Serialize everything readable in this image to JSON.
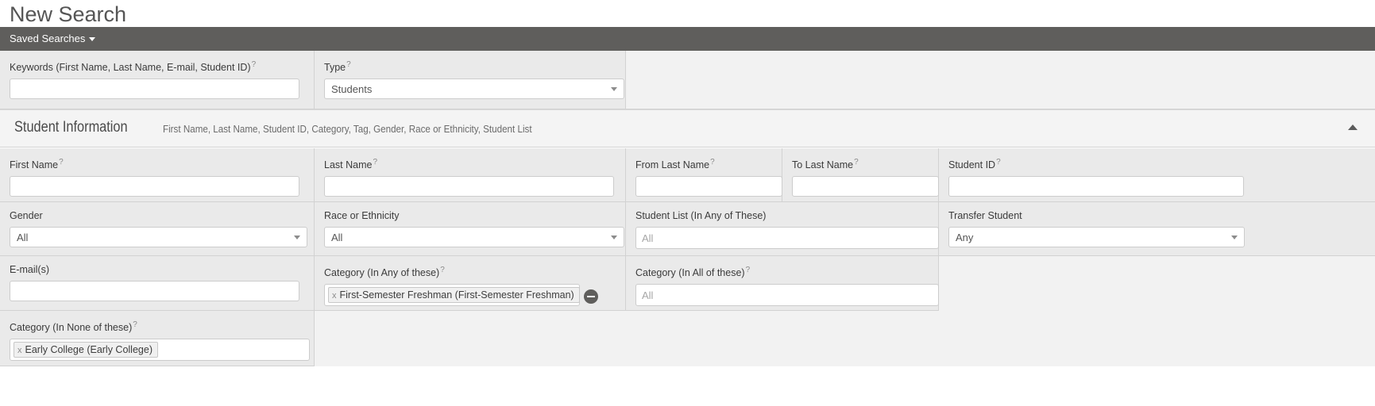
{
  "page": {
    "title": "New Search"
  },
  "toolbar": {
    "saved_searches_label": "Saved Searches"
  },
  "quick": {
    "keywords": {
      "label": "Keywords (First Name, Last Name, E-mail, Student ID)",
      "help": "?",
      "value": "",
      "placeholder": ""
    },
    "type": {
      "label": "Type",
      "help": "?",
      "value": "Students"
    }
  },
  "section": {
    "title": "Student Information",
    "subtitle": "First Name, Last Name, Student ID, Category, Tag, Gender, Race or Ethnicity, Student List",
    "collapse_icon": "caret-up-icon"
  },
  "fields": {
    "first_name": {
      "label": "First Name",
      "help": "?",
      "value": "",
      "placeholder": ""
    },
    "last_name": {
      "label": "Last Name",
      "help": "?",
      "value": "",
      "placeholder": ""
    },
    "from_last_name": {
      "label": "From Last Name",
      "help": "?",
      "value": "",
      "placeholder": ""
    },
    "to_last_name": {
      "label": "To Last Name",
      "help": "?",
      "value": "",
      "placeholder": ""
    },
    "student_id": {
      "label": "Student ID",
      "help": "?",
      "value": "",
      "placeholder": ""
    },
    "gender": {
      "label": "Gender",
      "value": "All"
    },
    "race": {
      "label": "Race or Ethnicity",
      "value": "All"
    },
    "student_list": {
      "label": "Student List (In Any of These)",
      "value": "",
      "placeholder": "All"
    },
    "transfer": {
      "label": "Transfer Student",
      "value": "Any"
    },
    "emails": {
      "label": "E-mail(s)",
      "value": "",
      "placeholder": ""
    },
    "category_any": {
      "label": "Category (In Any of these)",
      "help": "?",
      "chips": [
        {
          "remove": "x",
          "text": "First-Semester Freshman (First-Semester Freshman)"
        }
      ],
      "remove_button": "minus-icon"
    },
    "category_all": {
      "label": "Category (In All of these)",
      "help": "?",
      "value": "",
      "placeholder": "All"
    },
    "category_none": {
      "label": "Category (In None of these)",
      "help": "?",
      "chips": [
        {
          "remove": "x",
          "text": "Early College (Early College)"
        }
      ]
    }
  },
  "colors": {
    "toolbar_bg": "#5f5e5c",
    "cell_bg": "#eaeaea",
    "section_bg": "#f4f4f4",
    "border": "#d2d2d2"
  }
}
